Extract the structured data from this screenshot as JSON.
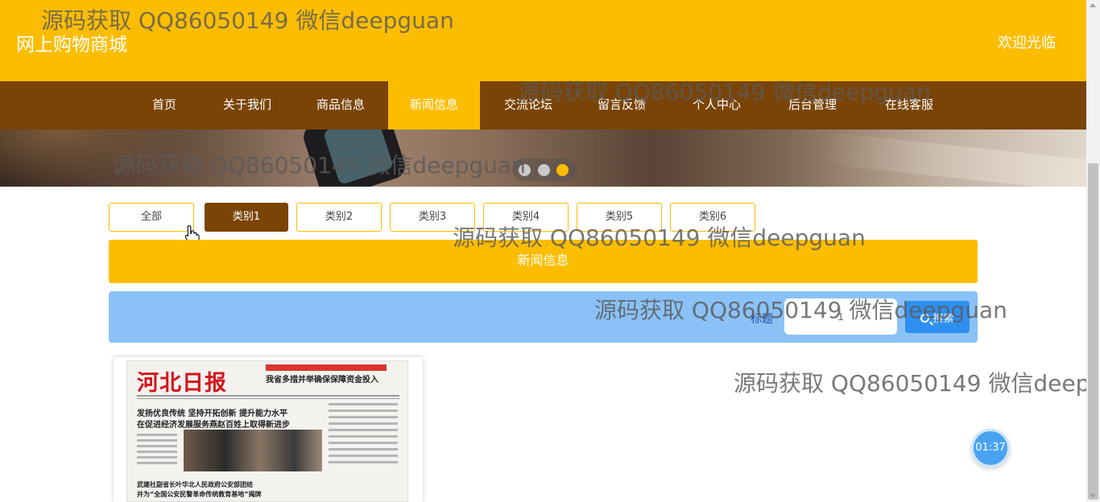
{
  "header": {
    "site_title": "网上购物商城",
    "welcome": "欢迎光临"
  },
  "nav": {
    "items": [
      {
        "label": "首页"
      },
      {
        "label": "关于我们"
      },
      {
        "label": "商品信息"
      },
      {
        "label": "新闻信息",
        "active": true
      },
      {
        "label": "交流论坛"
      },
      {
        "label": "留言反馈"
      },
      {
        "label": "个人中心"
      },
      {
        "label": "后台管理"
      },
      {
        "label": "在线客服"
      }
    ]
  },
  "carousel": {
    "active_index": 3,
    "count": 3
  },
  "categories": {
    "items": [
      {
        "label": "全部"
      },
      {
        "label": "类别1",
        "active": true
      },
      {
        "label": "类别2"
      },
      {
        "label": "类别3"
      },
      {
        "label": "类别4"
      },
      {
        "label": "类别5"
      },
      {
        "label": "类别6"
      }
    ]
  },
  "section": {
    "title": "新闻信息"
  },
  "search": {
    "label": "标题",
    "value": "1",
    "button_label": "搜索"
  },
  "news": {
    "items": [
      {
        "masthead": "河北日报",
        "subhead": "我省多措并举确保保障资金投入",
        "headline_1": "发扬优良传统  坚持开拓创新  提升能力水平",
        "headline_2": "在促进经济发展服务燕赵百姓上取得新进步",
        "headline_3": "武建社副省长叶华北人民政府公安部团结",
        "headline_4": "并为“全国公安民警革命传统教育基地”揭牌"
      }
    ]
  },
  "timer": {
    "text": "01:37"
  },
  "watermark": {
    "text": "源码获取 QQ86050149 微信deepguan"
  },
  "colors": {
    "primary": "#fcbd00",
    "nav_bg": "#7a4406",
    "search_bg": "#8ac2f7",
    "button_blue": "#2f8ff0"
  }
}
